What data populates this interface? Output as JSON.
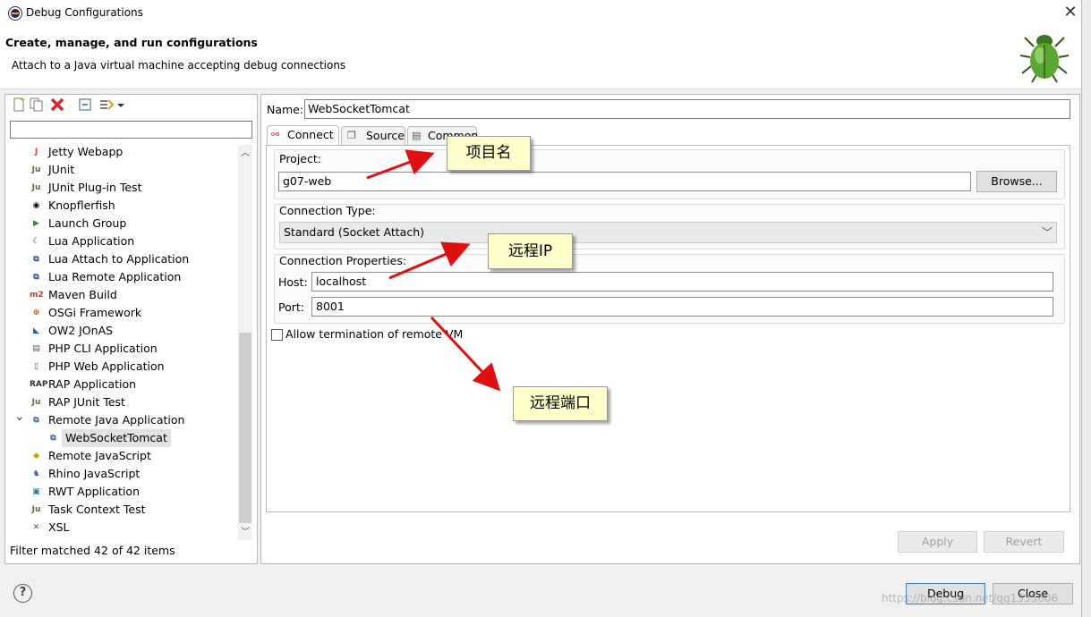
{
  "window": {
    "title": "Debug Configurations",
    "close_glyph": "✕"
  },
  "header": {
    "title": "Create, manage, and run configurations",
    "subtitle": "Attach to a Java virtual machine accepting debug connections",
    "icon": "bug-icon"
  },
  "toolbar": {
    "icons": [
      "new-configuration-icon",
      "duplicate-icon",
      "delete-icon",
      "collapse-all-icon",
      "filter-icon",
      "dropdown-icon"
    ]
  },
  "filter": {
    "value": "",
    "status": "Filter matched 42 of 42 items"
  },
  "tree": {
    "items": [
      {
        "label": "Jetty Webapp",
        "icon": "jetty-icon",
        "glyph": "J",
        "color": "#d64a1d"
      },
      {
        "label": "JUnit",
        "icon": "junit-icon",
        "glyph": "Ju",
        "color": "#5a6e2c"
      },
      {
        "label": "JUnit Plug-in Test",
        "icon": "junit-plugin-icon",
        "glyph": "Ju",
        "color": "#5a6e2c"
      },
      {
        "label": "Knopflerfish",
        "icon": "knopflerfish-icon",
        "glyph": "◉",
        "color": "#000000"
      },
      {
        "label": "Launch Group",
        "icon": "launch-group-icon",
        "glyph": "▶",
        "color": "#2e8b3a"
      },
      {
        "label": "Lua Application",
        "icon": "lua-icon",
        "glyph": "☾",
        "color": "#2a4c8a"
      },
      {
        "label": "Lua Attach to Application",
        "icon": "lua-attach-icon",
        "glyph": "⧉",
        "color": "#2a4c8a"
      },
      {
        "label": "Lua Remote Application",
        "icon": "lua-remote-icon",
        "glyph": "⧉",
        "color": "#2a4c8a"
      },
      {
        "label": "Maven Build",
        "icon": "maven-icon",
        "glyph": "m2",
        "color": "#c0392b"
      },
      {
        "label": "OSGi Framework",
        "icon": "osgi-icon",
        "glyph": "⊕",
        "color": "#b5651d"
      },
      {
        "label": "OW2 JOnAS",
        "icon": "jonas-icon",
        "glyph": "◣",
        "color": "#1a6ab0"
      },
      {
        "label": "PHP CLI Application",
        "icon": "php-cli-icon",
        "glyph": "▤",
        "color": "#555555"
      },
      {
        "label": "PHP Web Application",
        "icon": "php-web-icon",
        "glyph": "▯",
        "color": "#555555"
      },
      {
        "label": "RAP Application",
        "icon": "rap-icon",
        "glyph": "RAP",
        "color": "#333333"
      },
      {
        "label": "RAP JUnit Test",
        "icon": "rap-junit-icon",
        "glyph": "Ju",
        "color": "#5a6e2c"
      },
      {
        "label": "Remote Java Application",
        "icon": "remote-java-icon",
        "glyph": "⧉",
        "color": "#3b5f8f",
        "expanded": true
      },
      {
        "label": "WebSocketTomcat",
        "icon": "remote-config-icon",
        "glyph": "⧉",
        "color": "#3b5f8f",
        "child": true,
        "selected": true
      },
      {
        "label": "Remote JavaScript",
        "icon": "remote-js-icon",
        "glyph": "◆",
        "color": "#c9a300"
      },
      {
        "label": "Rhino JavaScript",
        "icon": "rhino-icon",
        "glyph": "♞",
        "color": "#3b5f8f"
      },
      {
        "label": "RWT Application",
        "icon": "rwt-icon",
        "glyph": "▣",
        "color": "#2a7a9a"
      },
      {
        "label": "Task Context Test",
        "icon": "task-context-icon",
        "glyph": "Ju",
        "color": "#5a6e2c"
      },
      {
        "label": "XSL",
        "icon": "xsl-icon",
        "glyph": "✕",
        "color": "#555555"
      }
    ]
  },
  "config": {
    "name_label": "Name:",
    "name_value": "WebSocketTomcat",
    "tabs": [
      {
        "label": "Connect",
        "icon": "connect-icon",
        "active": true
      },
      {
        "label": "Source",
        "icon": "source-icon"
      },
      {
        "label": "Common",
        "icon": "common-icon"
      }
    ],
    "project_label": "Project:",
    "project_value": "g07-web",
    "browse_label": "Browse...",
    "conn_type_label": "Connection Type:",
    "conn_type_value": "Standard (Socket Attach)",
    "conn_props_label": "Connection Properties:",
    "host_label": "Host:",
    "host_value": "localhost",
    "port_label": "Port:",
    "port_value": "8001",
    "allow_term_label": "Allow termination of remote VM"
  },
  "buttons": {
    "apply": "Apply",
    "revert": "Revert",
    "debug": "Debug",
    "close": "Close"
  },
  "annotations": {
    "project_note": "项目名",
    "ip_note": "远程IP",
    "port_note": "远程端口",
    "arrow_color": "#e01010"
  },
  "watermark": "https://blog.csdn.net/qq1335606"
}
